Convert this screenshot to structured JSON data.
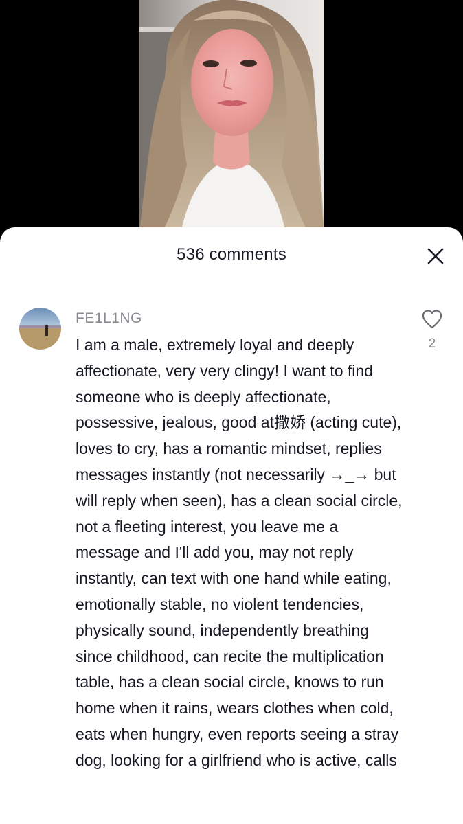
{
  "comments_panel": {
    "title": "536 comments",
    "close_icon": "close-icon"
  },
  "comment": {
    "username": "FE1L1NG",
    "text": "I am a male, extremely loyal and deeply affectionate, very very clingy! I want to find someone who is deeply affectionate, possessive, jealous, good at撒娇 (acting cute), loves to cry, has a romantic mindset, replies messages instantly (not necessarily →_→ but will reply when seen), has a clean social circle, not a fleeting interest, you leave me a message and I'll add you, may not reply instantly, can text with one hand while eating, emotionally stable, no violent tendencies, physically sound, independently breathing since childhood, can recite the multiplication table, has a clean social circle, knows to run home when it rains, wears clothes when cold, eats when hungry, even reports seeing a stray dog, looking for a girlfriend who is active, calls",
    "like_icon": "heart-outline-icon",
    "like_count": "2"
  },
  "colors": {
    "sheet_background": "#ffffff",
    "text_primary": "#161823",
    "text_secondary": "#8a8b91",
    "video_background": "#000000"
  }
}
